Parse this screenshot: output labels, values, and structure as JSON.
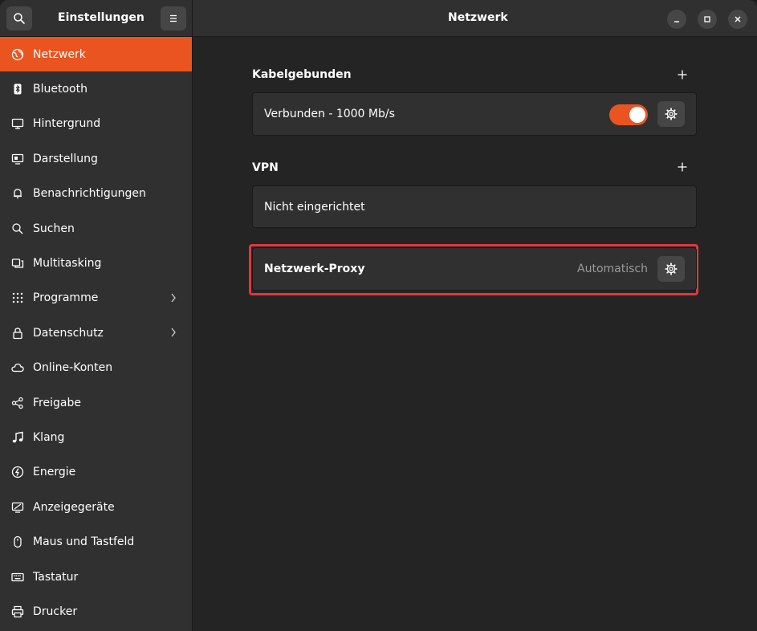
{
  "header": {
    "sidebar_title": "Einstellungen",
    "content_title": "Netzwerk",
    "search_icon": "search-icon",
    "menu_icon": "hamburger-menu-icon",
    "window_controls": [
      "minimize",
      "maximize",
      "close"
    ]
  },
  "sidebar": {
    "items": [
      {
        "label": "Netzwerk",
        "icon": "network-icon",
        "active": true
      },
      {
        "label": "Bluetooth",
        "icon": "bluetooth-icon"
      },
      {
        "label": "Hintergrund",
        "icon": "background-icon"
      },
      {
        "label": "Darstellung",
        "icon": "appearance-icon"
      },
      {
        "label": "Benachrichtigungen",
        "icon": "bell-icon"
      },
      {
        "label": "Suchen",
        "icon": "search-icon"
      },
      {
        "label": "Multitasking",
        "icon": "multitasking-icon"
      },
      {
        "label": "Programme",
        "icon": "apps-grid-icon",
        "chevron": true
      },
      {
        "label": "Datenschutz",
        "icon": "lock-icon",
        "chevron": true
      },
      {
        "label": "Online-Konten",
        "icon": "cloud-icon"
      },
      {
        "label": "Freigabe",
        "icon": "share-icon"
      },
      {
        "label": "Klang",
        "icon": "music-note-icon"
      },
      {
        "label": "Energie",
        "icon": "power-icon"
      },
      {
        "label": "Anzeigegeräte",
        "icon": "display-icon"
      },
      {
        "label": "Maus und Tastfeld",
        "icon": "mouse-icon"
      },
      {
        "label": "Tastatur",
        "icon": "keyboard-icon"
      },
      {
        "label": "Drucker",
        "icon": "printer-icon"
      }
    ]
  },
  "main": {
    "wired": {
      "title": "Kabelgebunden",
      "status": "Verbunden - 1000 Mb/s",
      "enabled": true
    },
    "vpn": {
      "title": "VPN",
      "status": "Nicht eingerichtet"
    },
    "proxy": {
      "title": "Netzwerk-Proxy",
      "value": "Automatisch"
    }
  },
  "colors": {
    "accent": "#e95420",
    "highlight": "#e0373f"
  }
}
